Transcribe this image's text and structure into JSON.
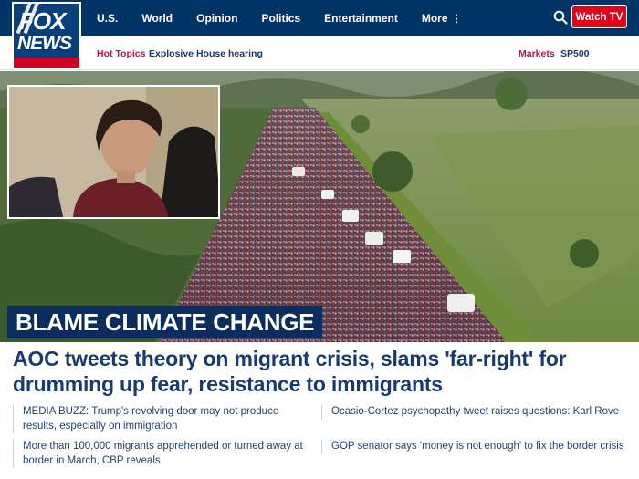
{
  "brand": {
    "logo_line1": "FOX",
    "logo_line2": "NEWS"
  },
  "nav": {
    "items": [
      "U.S.",
      "World",
      "Opinion",
      "Politics",
      "Entertainment"
    ],
    "more_label": "More",
    "more_glyph": "⋮",
    "watch_label": "Watch TV"
  },
  "subnav": {
    "hot_topics_label": "Hot Topics",
    "hot_topic": "Explosive House hearing",
    "markets_label": "Markets",
    "markets_ticker": "SP500"
  },
  "hero": {
    "kicker": "BLAME CLIMATE CHANGE"
  },
  "headline": "AOC tweets theory on migrant crisis, slams 'far-right' for drumming up fear, resistance to immigrants",
  "related": [
    "MEDIA BUZZ: Trump's revolving door may not produce results, especially on immigration",
    "Ocasio-Cortez psychopathy tweet raises questions: Karl Rove",
    "More than 100,000 migrants apprehended or turned away at border in March, CBP reveals",
    "GOP senator says 'money is not enough' to fix the border crisis"
  ],
  "colors": {
    "nav_bg": "#003366",
    "watch_button": "#e3001b",
    "hot_label": "#c8102e",
    "headline": "#173a70",
    "kicker_bg": "#0b2d5e"
  },
  "icons": {
    "search": "search-icon"
  }
}
